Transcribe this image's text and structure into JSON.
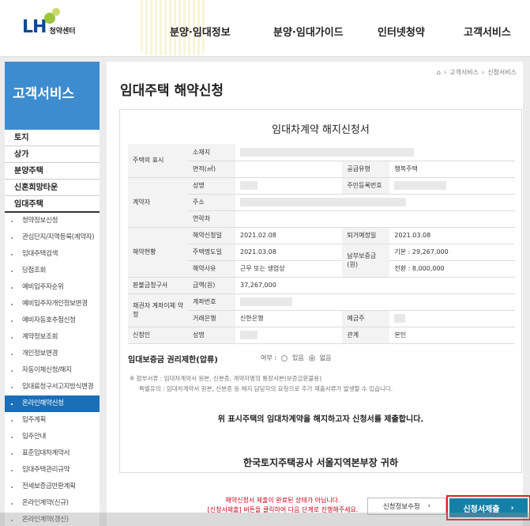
{
  "header": {
    "logo_text": "LH",
    "logo_sub": "청약센터",
    "nav": [
      "분양·임대정보",
      "분양·임대가이드",
      "인터넷청약",
      "고객서비스"
    ]
  },
  "sidebar": {
    "title": "고객서비스",
    "top_items": [
      "토지",
      "상가",
      "분양주택",
      "신혼희망타운",
      "임대주택"
    ],
    "sub_items": [
      "청약정보신청",
      "관심단지/지역등록(계약자)",
      "임대주택검색",
      "당첨조회",
      "예비입주자순위",
      "예비입주자개인정보변경",
      "예비자동호추첨신청",
      "계약정보조회",
      "개인정보변경",
      "자동이체신청/해지",
      "임대료청구서고지방식변경",
      "온라인해약신청",
      "입주계획",
      "입주안내",
      "표준임대차계약서",
      "임대주택관리규약",
      "전세보증금반환계획",
      "온라인계약(신규)",
      "온라인계약(갱신)"
    ],
    "active_sub": "온라인해약신청"
  },
  "breadcrumb": [
    "고객서비스",
    "신청서비스"
  ],
  "page_title": "임대주택 해약신청",
  "form": {
    "title": "임대차계약 해지신청서",
    "labels": {
      "house": "주택의 표시",
      "location": "소재지",
      "area": "면적(㎡)",
      "supply_type_label": "공급유형",
      "supply_type": "행복주택",
      "contractor": "계약자",
      "name": "성명",
      "rrn": "주민등록번호",
      "address": "주소",
      "contact": "연락처",
      "status": "해약현황",
      "cancel_date_label": "해약신청일",
      "cancel_date": "2021.02.08",
      "moveout_label": "퇴거예정일",
      "moveout": "2021.03.08",
      "clear_date_label": "주택명도일",
      "clear_date": "2021.03.08",
      "deposit_label": "납부보증금(원)",
      "deposit_base_label": "기본 :",
      "deposit_base": "29,267,000",
      "deposit_conv_label": "전환 :",
      "deposit_conv": "8,000,000",
      "reason_label": "해약사유",
      "reason": "근무 또는 생업상",
      "refund": "환불금청구서",
      "amount_label": "금액(원)",
      "amount": "37,267,000",
      "account_section": "채권자 계좌이체 약정",
      "account_no": "계좌번호",
      "bank_label": "거래은행",
      "bank": "신한은행",
      "holder_label": "예금주",
      "applicant": "신청인",
      "applicant_name": "성명",
      "relation_label": "관계",
      "relation": "본인"
    },
    "restrict_title": "임대보증금 권리제한(압류)",
    "restrict_label": "여부 :",
    "restrict_yes": "있음",
    "restrict_no": "없음",
    "note1": "※ 첨부서류 : 임대차계약서 원본, 신분증, 계약자명의 통장사본(보증금환불용)",
    "note2": "특별유의 : 임대차계약서 원본, 신분증 등 해지 담당자의 요청으로 추가 제출서류가 발생할 수 있습니다.",
    "declaration": "위 표시주택의 임대차계약을 해지하고자 신청서를 제출합니다.",
    "recipient": "한국토지주택공사 서울지역본부장 귀하"
  },
  "footer": {
    "warning_line1": "해약신청서 제출이 완료된 상태가 아닙니다.",
    "warning_line2": "[신청서제출] 버튼을 클릭하여 다음 단계로 진행해주세요.",
    "edit_button": "신청정보수정",
    "submit_button": "신청서제출"
  }
}
